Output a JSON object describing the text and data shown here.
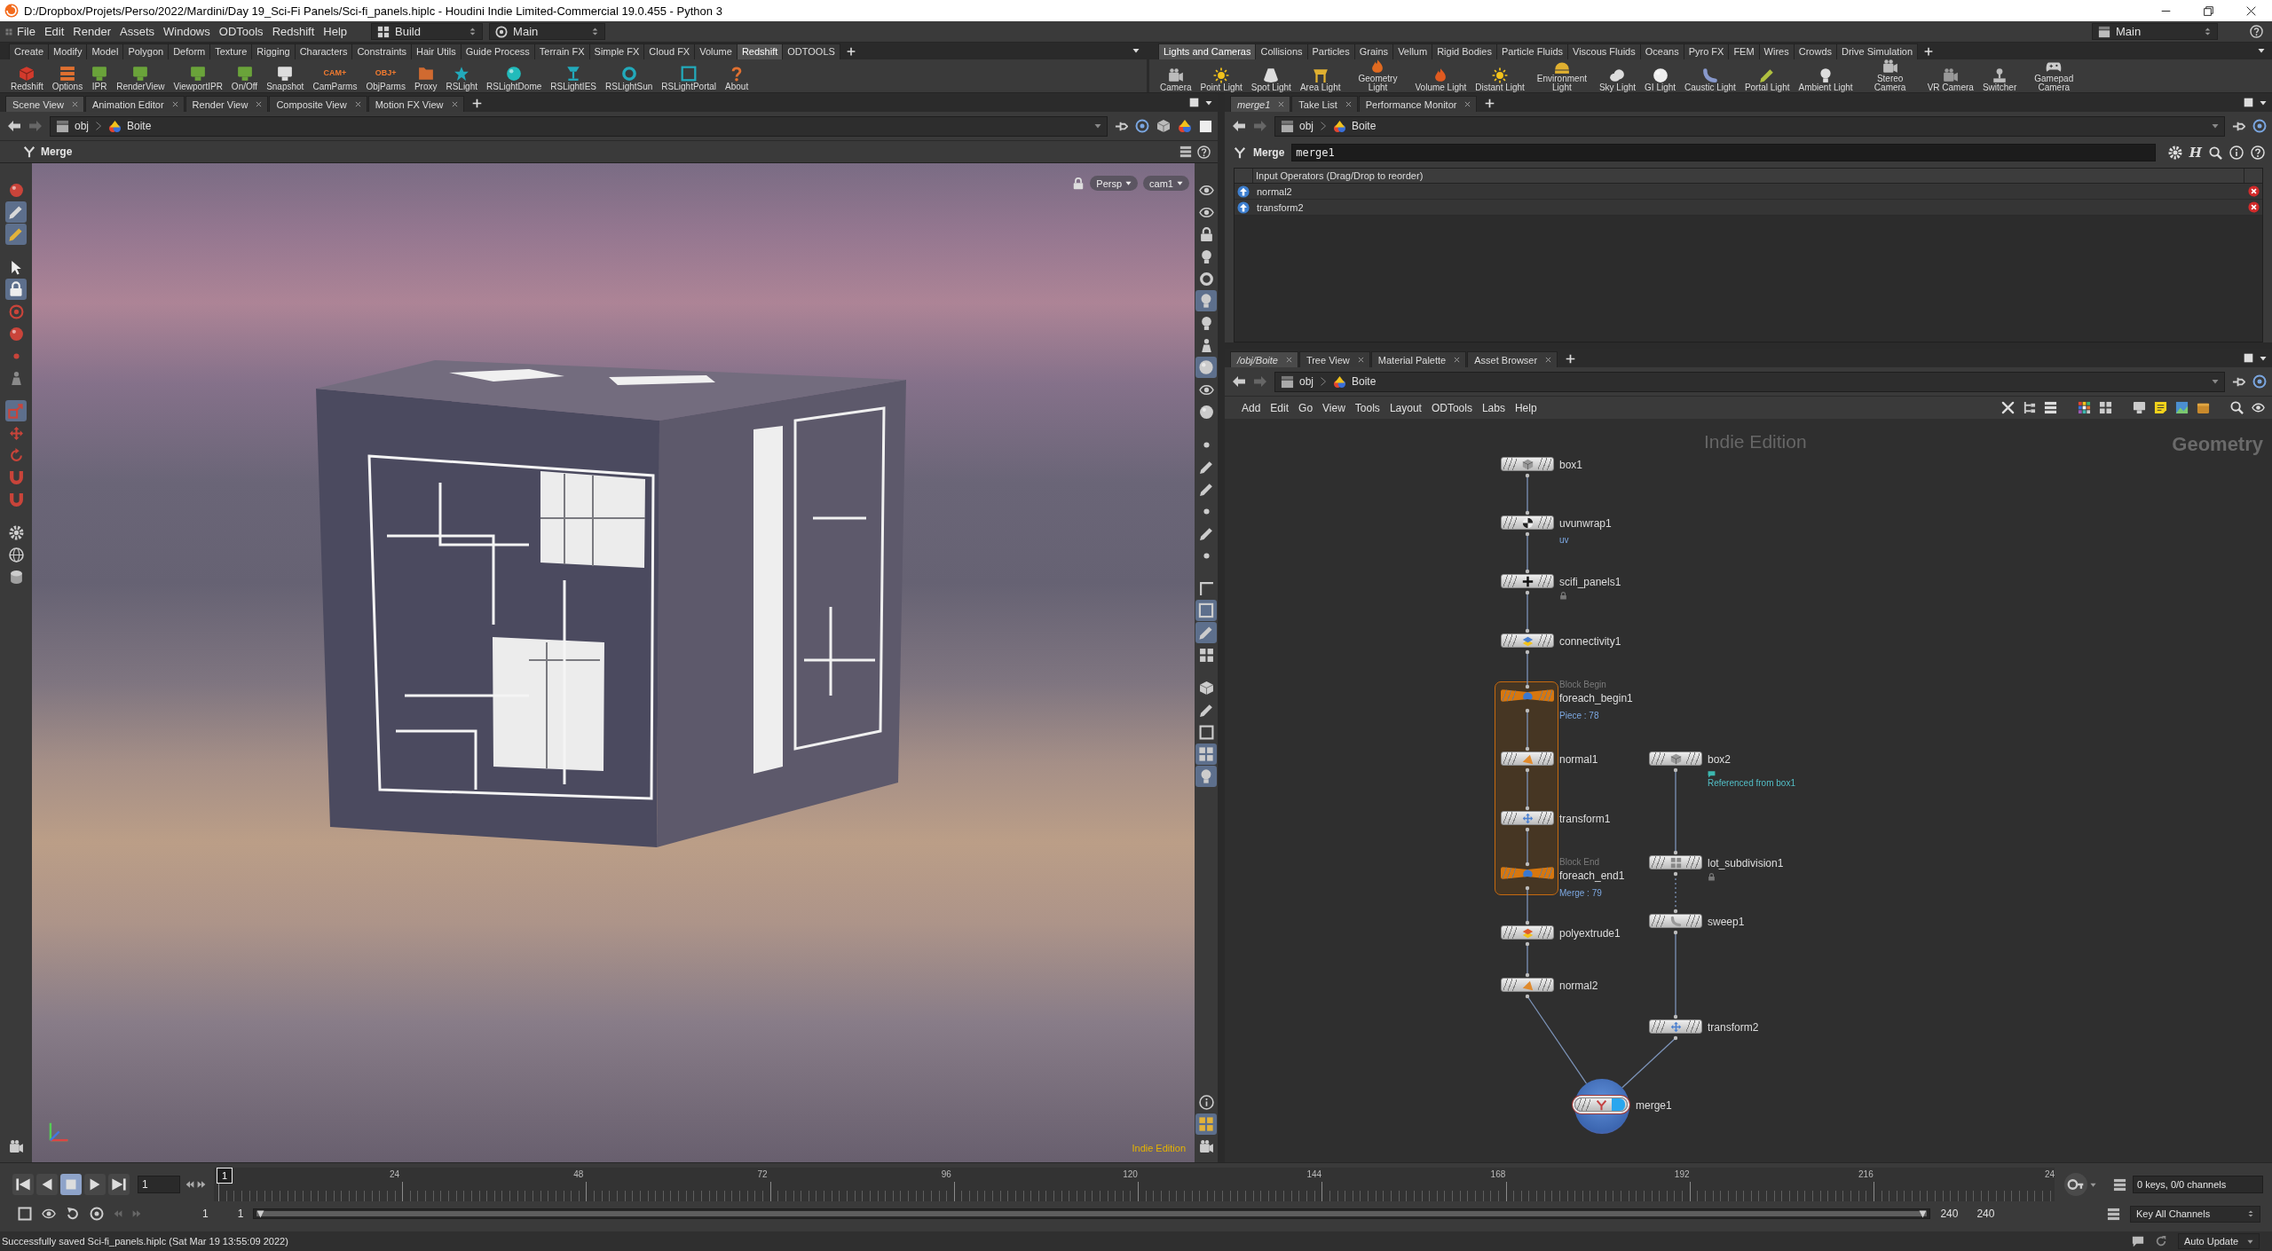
{
  "window": {
    "title": "D:/Dropbox/Projets/Perso/2022/Mardini/Day 19_Sci-Fi Panels/Sci-fi_panels.hiplc - Houdini Indie Limited-Commercial 19.0.455 - Python 3"
  },
  "menu_bar": {
    "menus": [
      "File",
      "Edit",
      "Render",
      "Assets",
      "Windows",
      "ODTools",
      "Redshift",
      "Help"
    ],
    "desktop": "Build",
    "context": "Main",
    "right_context": "Main"
  },
  "shelves": [
    {
      "tabs": [
        {
          "label": "Create",
          "selected": false
        },
        {
          "label": "Modify",
          "selected": false
        },
        {
          "label": "Model",
          "selected": false
        },
        {
          "label": "Polygon",
          "selected": false
        },
        {
          "label": "Deform",
          "selected": false
        },
        {
          "label": "Texture",
          "selected": false
        },
        {
          "label": "Rigging",
          "selected": false
        },
        {
          "label": "Characters",
          "selected": false
        },
        {
          "label": "Constraints",
          "selected": false
        },
        {
          "label": "Hair Utils",
          "selected": false
        },
        {
          "label": "Guide Process",
          "selected": false
        },
        {
          "label": "Terrain FX",
          "selected": false
        },
        {
          "label": "Simple FX",
          "selected": false
        },
        {
          "label": "Cloud FX",
          "selected": false
        },
        {
          "label": "Volume",
          "selected": false
        },
        {
          "label": "Redshift",
          "selected": true
        },
        {
          "label": "ODTOOLS",
          "selected": false
        }
      ],
      "tools": [
        {
          "label": "Redshift"
        },
        {
          "label": "Options"
        },
        {
          "label": "IPR"
        },
        {
          "label": "RenderView"
        },
        {
          "label": "ViewportIPR"
        },
        {
          "label": "On/Off"
        },
        {
          "label": "Snapshot"
        },
        {
          "label": "CamParms",
          "badge": "CAM+"
        },
        {
          "label": "ObjParms",
          "badge": "OBJ+"
        },
        {
          "label": "Proxy"
        },
        {
          "label": "RSLight"
        },
        {
          "label": "RSLightDome"
        },
        {
          "label": "RSLightIES"
        },
        {
          "label": "RSLightSun"
        },
        {
          "label": "RSLightPortal"
        },
        {
          "label": "About"
        }
      ]
    },
    {
      "tabs": [
        {
          "label": "Lights and Cameras",
          "selected": true
        },
        {
          "label": "Collisions",
          "selected": false
        },
        {
          "label": "Particles",
          "selected": false
        },
        {
          "label": "Grains",
          "selected": false
        },
        {
          "label": "Vellum",
          "selected": false
        },
        {
          "label": "Rigid Bodies",
          "selected": false
        },
        {
          "label": "Particle Fluids",
          "selected": false
        },
        {
          "label": "Viscous Fluids",
          "selected": false
        },
        {
          "label": "Oceans",
          "selected": false
        },
        {
          "label": "Pyro FX",
          "selected": false
        },
        {
          "label": "FEM",
          "selected": false
        },
        {
          "label": "Wires",
          "selected": false
        },
        {
          "label": "Crowds",
          "selected": false
        },
        {
          "label": "Drive Simulation",
          "selected": false
        }
      ],
      "tools": [
        {
          "label": "Camera"
        },
        {
          "label": "Point Light"
        },
        {
          "label": "Spot Light"
        },
        {
          "label": "Area Light"
        },
        {
          "label": "Geometry Light"
        },
        {
          "label": "Volume Light"
        },
        {
          "label": "Distant Light"
        },
        {
          "label": "Environment Light"
        },
        {
          "label": "Sky Light"
        },
        {
          "label": "GI Light"
        },
        {
          "label": "Caustic Light"
        },
        {
          "label": "Portal Light"
        },
        {
          "label": "Ambient Light"
        },
        {
          "label": "Stereo Camera"
        },
        {
          "label": "VR Camera"
        },
        {
          "label": "Switcher"
        },
        {
          "label": "Gamepad Camera"
        }
      ]
    }
  ],
  "scene_view": {
    "tabs": [
      {
        "label": "Scene View",
        "selected": true
      },
      {
        "label": "Animation Editor",
        "selected": false
      },
      {
        "label": "Render View",
        "selected": false
      },
      {
        "label": "Composite View",
        "selected": false
      },
      {
        "label": "Motion FX View",
        "selected": false
      }
    ],
    "path": [
      "obj",
      "Boite"
    ],
    "node_type": "Merge",
    "left_tools": [
      {
        "on": false
      },
      {
        "on": true
      },
      {
        "on": true
      },
      {
        "on": false
      },
      {
        "on": true
      },
      {
        "on": false
      },
      {
        "on": false
      },
      {
        "on": false
      },
      {
        "on": false
      },
      {
        "on": true
      },
      {
        "on": false
      },
      {
        "on": false
      },
      {
        "on": false
      },
      {
        "on": false
      },
      {
        "on": false
      },
      {
        "on": false
      },
      {
        "on": false
      },
      {
        "on": false
      }
    ],
    "right_tools": [
      {
        "on": false
      },
      {
        "on": false
      },
      {
        "on": false
      },
      {
        "on": false
      },
      {
        "on": false
      },
      {
        "on": true
      },
      {
        "on": false
      },
      {
        "on": false
      },
      {
        "on": true
      },
      {
        "on": false
      },
      {
        "on": false
      },
      {
        "on": false
      },
      {
        "on": false
      },
      {
        "on": false
      },
      {
        "on": false
      },
      {
        "on": false
      },
      {
        "on": false
      },
      {
        "on": false
      },
      {
        "on": true
      },
      {
        "on": true
      },
      {
        "on": false
      },
      {
        "on": false
      },
      {
        "on": false
      },
      {
        "on": false
      },
      {
        "on": true
      },
      {
        "on": true
      },
      {
        "on": false
      },
      {
        "on": true
      },
      {
        "on": false
      }
    ],
    "camera_menus": [
      "Persp",
      "cam1"
    ],
    "edition_label": "Indie Edition"
  },
  "parameters": {
    "tabs": [
      {
        "label": "merge1",
        "selected": true
      },
      {
        "label": "Take List",
        "selected": false
      },
      {
        "label": "Performance Monitor",
        "selected": false
      }
    ],
    "path": [
      "obj",
      "Boite"
    ],
    "node_type": "Merge",
    "node_name": "merge1",
    "asset_button": "H",
    "list_header": "Input Operators (Drag/Drop to reorder)",
    "inputs": [
      "normal2",
      "transform2"
    ]
  },
  "network": {
    "tabs": [
      {
        "label": "/obj/Boite",
        "selected": true
      },
      {
        "label": "Tree View",
        "selected": false
      },
      {
        "label": "Material Palette",
        "selected": false
      },
      {
        "label": "Asset Browser",
        "selected": false
      }
    ],
    "path": [
      "obj",
      "Boite"
    ],
    "menus": [
      "Add",
      "Edit",
      "Go",
      "View",
      "Tools",
      "Layout",
      "ODTools",
      "Labs",
      "Help"
    ],
    "edition_label": "Indie Edition",
    "context_label": "Geometry",
    "columns": [
      {
        "nodes": [
          {
            "label": "box1",
            "kind": "sop",
            "dotted_output": false,
            "locked": false,
            "selected": false,
            "display": false
          },
          {
            "label": "uvunwrap1",
            "kind": "sop",
            "dotted_output": false,
            "note": "uv",
            "locked": false,
            "selected": false,
            "display": false
          },
          {
            "label": "scifi_panels1",
            "kind": "sop",
            "dotted_output": false,
            "locked": true,
            "selected": false,
            "display": false
          },
          {
            "label": "connectivity1",
            "kind": "sop",
            "dotted_output": false,
            "locked": false,
            "selected": false,
            "display": false
          },
          {
            "label": "foreach_begin1",
            "kind": "block_begin",
            "tag": "Block Begin",
            "note": "Piece : 78",
            "dotted_output": false,
            "locked": false,
            "selected": false,
            "display": false
          },
          {
            "label": "normal1",
            "kind": "sop",
            "dotted_output": false,
            "locked": false,
            "selected": false,
            "display": false
          },
          {
            "label": "transform1",
            "kind": "sop",
            "dotted_output": false,
            "locked": false,
            "selected": false,
            "display": false
          },
          {
            "label": "foreach_end1",
            "kind": "block_end",
            "tag": "Block End",
            "note": "Merge : 79",
            "dotted_output": false,
            "locked": false,
            "selected": false,
            "display": false
          },
          {
            "label": "polyextrude1",
            "kind": "sop",
            "dotted_output": false,
            "locked": false,
            "selected": false,
            "display": false
          },
          {
            "label": "normal2",
            "kind": "sop",
            "dotted_output": false,
            "locked": false,
            "selected": false,
            "display": false
          }
        ]
      },
      {
        "nodes": [
          {
            "label": "box2",
            "kind": "sop",
            "dotted_output": false,
            "comment": "Referenced from box1",
            "locked": false,
            "selected": false,
            "display": false
          },
          {
            "label": "lot_subdivision1",
            "kind": "sop",
            "dotted_output": true,
            "locked": true,
            "selected": false,
            "display": false
          },
          {
            "label": "sweep1",
            "kind": "sop",
            "dotted_output": false,
            "locked": false,
            "selected": false,
            "display": false
          },
          {
            "label": "transform2",
            "kind": "sop",
            "dotted_output": false,
            "locked": false,
            "selected": false,
            "display": false
          }
        ]
      }
    ],
    "merge": {
      "label": "merge1",
      "kind": "merge",
      "selected": true,
      "display": true
    }
  },
  "timeline": {
    "transport": [
      {
        "kind": "start",
        "selected": false
      },
      {
        "kind": "back",
        "selected": false
      },
      {
        "kind": "stop",
        "selected": true
      },
      {
        "kind": "play",
        "selected": false
      },
      {
        "kind": "end",
        "selected": false
      }
    ],
    "frame": "1",
    "marker": "1",
    "ruler_labels": [
      "24",
      "48",
      "72",
      "96",
      "120",
      "144",
      "168",
      "192",
      "216",
      "24"
    ],
    "range_start": "1",
    "play_start": "1",
    "range_bar": {
      "level": 1
    },
    "play_end": "240",
    "range_end": "240",
    "keys_info": "0 keys, 0/0 channels",
    "key_mode": "Key All Channels"
  },
  "status_bar": {
    "message": "Successfully saved Sci-fi_panels.hiplc (Sat Mar 19 13:55:09 2022)",
    "update_mode": "Auto Update"
  }
}
